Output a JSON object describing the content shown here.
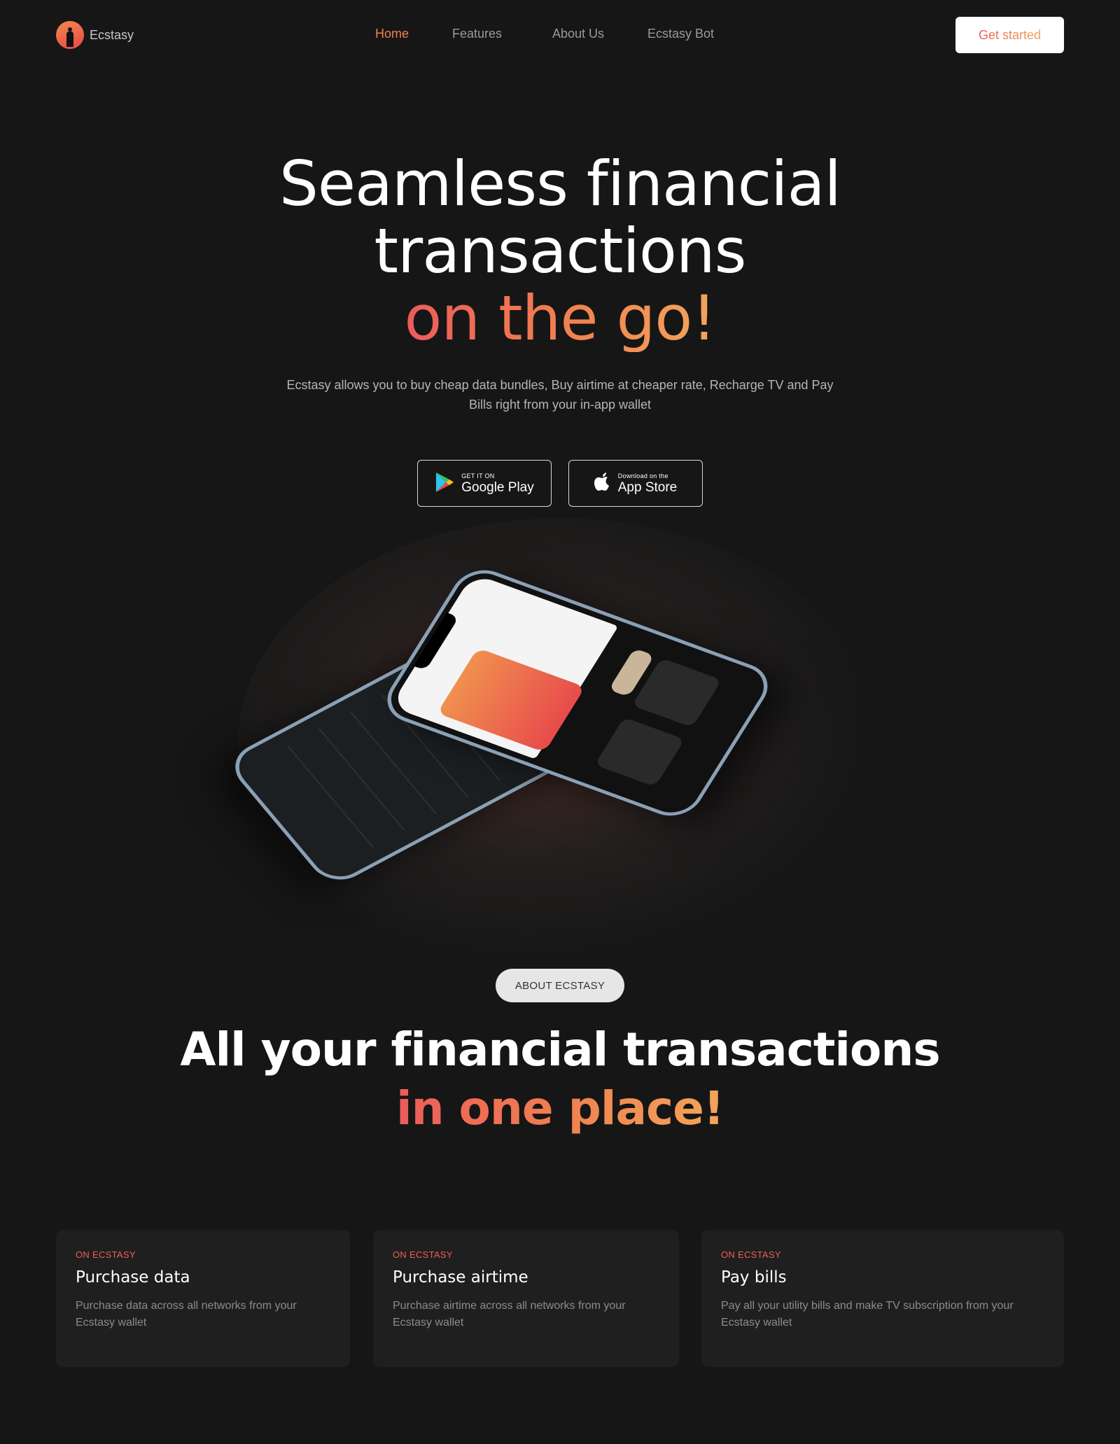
{
  "brand": {
    "name": "Ecstasy"
  },
  "nav": {
    "items": [
      {
        "label": "Home",
        "active": true
      },
      {
        "label": "Features",
        "active": false
      },
      {
        "label": "About Us",
        "active": false
      },
      {
        "label": "Ecstasy Bot",
        "active": false
      }
    ],
    "cta_label": "Get started"
  },
  "hero": {
    "title_line1": "Seamless financial",
    "title_line2": "transactions",
    "title_line3": "on the go!",
    "subtitle": "Ecstasy allows you to buy cheap data bundles, Buy airtime at cheaper rate, Recharge TV and Pay Bills right from your in-app wallet",
    "google_play": {
      "small": "GET IT ON",
      "big": "Google Play",
      "icon": "google-play-icon"
    },
    "app_store": {
      "small": "Download on the",
      "big": "App Store",
      "icon": "apple-icon"
    }
  },
  "about": {
    "pill": "ABOUT ECSTASY",
    "title_line1": "All your financial transactions",
    "title_line2": "in one place!"
  },
  "features": [
    {
      "tag": "ON ECSTASY",
      "title": "Purchase data",
      "description": "Purchase data across all networks from your Ecstasy wallet"
    },
    {
      "tag": "ON ECSTASY",
      "title": "Purchase airtime",
      "description": "Purchase airtime across all networks from your Ecstasy wallet"
    },
    {
      "tag": "ON ECSTASY",
      "title": "Pay bills",
      "description": "Pay all your utility bills and make TV subscription from your Ecstasy wallet"
    }
  ],
  "colors": {
    "background": "#161616",
    "accent_gradient_start": "#ec5b5b",
    "accent_gradient_end": "#f2a55a",
    "card_background": "#1f1f1f"
  }
}
